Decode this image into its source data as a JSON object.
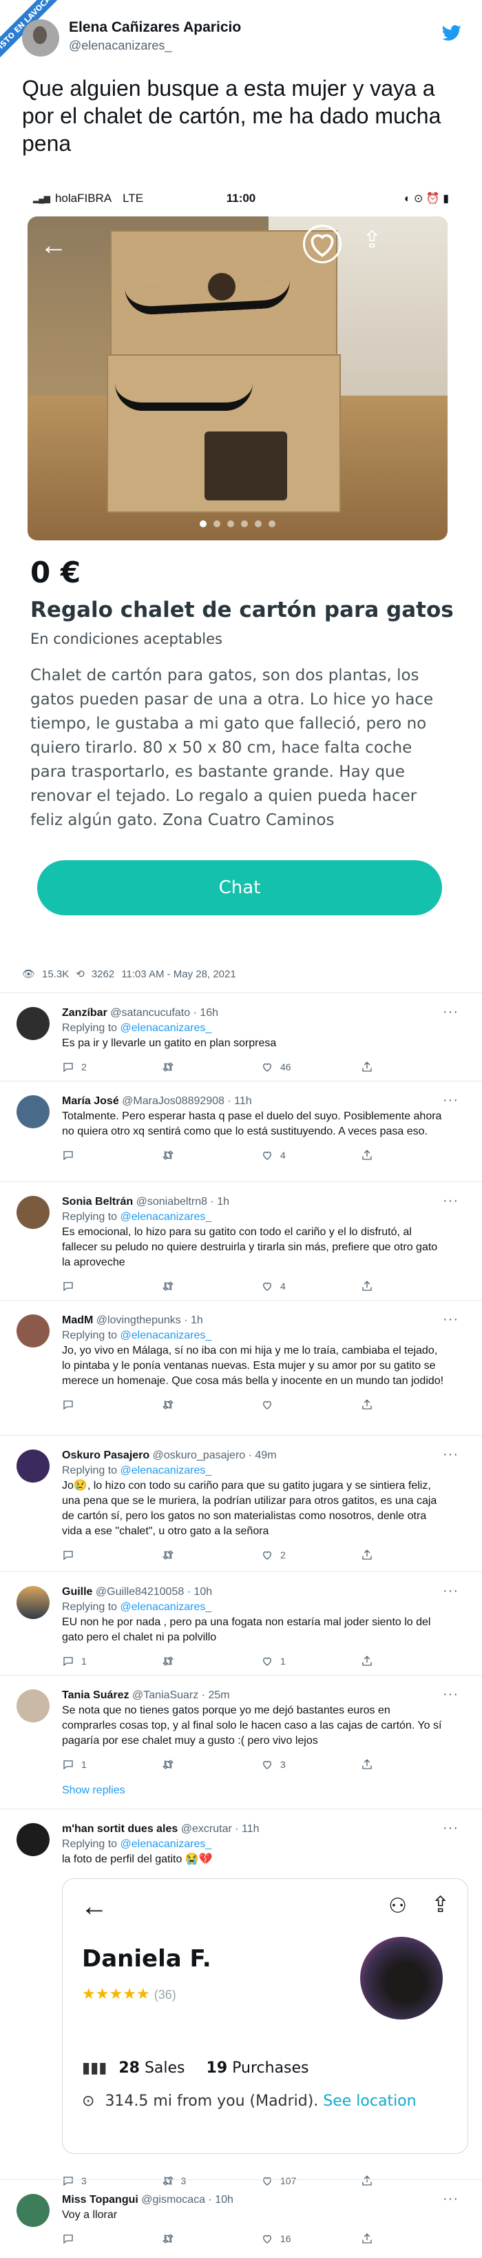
{
  "watermark": "VISTO EN LAVOCALUCA",
  "tweet": {
    "name": "Elena Cañizares Aparicio",
    "handle": "@elenacanizares_",
    "text": "Que alguien busque a esta mujer y vaya a por el chalet de cartón, me ha dado mucha pena",
    "views": "15.3K",
    "retweets": "3262",
    "timestamp": "11:03 AM - May 28, 2021"
  },
  "screenshot": {
    "carrier": "holaFIBRA",
    "network": "LTE",
    "time": "11:00",
    "price": "0 €",
    "title": "Regalo chalet de cartón para gatos",
    "condition": "En condiciones aceptables",
    "description": "Chalet de cartón para gatos, son dos plantas, los gatos pueden pasar de una a otra. Lo hice yo hace tiempo, le gustaba a mi gato que falleció, pero no quiero tirarlo. 80 x 50 x 80 cm, hace falta coche para trasportarlo, es bastante grande. Hay que renovar el tejado. Lo regalo a quien pueda hacer feliz algún gato. Zona Cuatro Caminos",
    "chat_label": "Chat",
    "colors": {
      "accent": "#13c1ac"
    }
  },
  "replies": [
    {
      "name": "Zanzíbar",
      "handle": "@satancucufato",
      "time": "16h",
      "to": "@elenacanizares_",
      "text": "Es pa ir y llevarle un gatito en plan sorpresa",
      "reply": "2",
      "rt": "",
      "like": "46"
    },
    {
      "name": "María José",
      "handle": "@MaraJos08892908",
      "time": "11h",
      "to": "",
      "text": "Totalmente. Pero esperar hasta q pase el duelo del suyo. Posiblemente ahora no quiera otro xq sentirá como que lo está sustituyendo. A veces pasa eso.",
      "reply": "",
      "rt": "",
      "like": "4"
    },
    {
      "name": "Sonia Beltrán",
      "handle": "@soniabeltrn8",
      "time": "1h",
      "to": "@elenacanizares_",
      "text": "Es emocional, lo hizo para su gatito con todo el cariño y el lo disfrutó, al fallecer su peludo no quiere destruirla y tirarla sin más, prefiere que otro gato la aproveche",
      "reply": "",
      "rt": "",
      "like": "4"
    },
    {
      "name": "MadM",
      "handle": "@lovingthepunks",
      "time": "1h",
      "to": "@elenacanizares_",
      "text": "Jo, yo vivo en Málaga, sí no iba con mi hija y me lo traía, cambiaba el tejado, lo pintaba y le ponía ventanas nuevas. Esta mujer y su amor por su gatito se merece un homenaje. Que cosa más bella y inocente en un mundo tan jodido!",
      "reply": "",
      "rt": "",
      "like": ""
    },
    {
      "name": "Oskuro Pasajero",
      "handle": "@oskuro_pasajero",
      "time": "49m",
      "to": "@elenacanizares_",
      "text": "Jo😢, lo hizo con todo su cariño para que su gatito jugara y se sintiera feliz, una pena que se le muriera, la podrían utilizar para otros gatitos, es una caja de cartón sí, pero los gatos no son materialistas como nosotros, denle otra vida a ese \"chalet\", u otro gato a la señora",
      "reply": "",
      "rt": "",
      "like": "2"
    },
    {
      "name": "Guille",
      "handle": "@Guille84210058",
      "time": "10h",
      "to": "@elenacanizares_",
      "text": "EU non he por nada , pero pa una fogata non estaría mal joder siento lo del gato pero el chalet ni pa polvillo",
      "reply": "1",
      "rt": "",
      "like": "1"
    },
    {
      "name": "Tania Suárez",
      "handle": "@TaniaSuarz",
      "time": "25m",
      "to": "",
      "text": "Se nota que no tienes gatos porque yo me dejó bastantes euros en comprarles cosas top, y al final solo le hacen caso a las cajas de cartón. Yo sí pagaría por ese chalet muy a gusto :( pero vivo lejos",
      "reply": "1",
      "rt": "",
      "like": "3"
    },
    {
      "name": "m'han sortit dues ales",
      "handle": "@excrutar",
      "time": "11h",
      "to": "@elenacanizares_",
      "text": "la foto de perfil del gatito 😭💔",
      "reply": "3",
      "rt": "3",
      "like": "107"
    },
    {
      "name": "Miss Topangui",
      "handle": "@gismocaca",
      "time": "10h",
      "to": "",
      "text": "Voy a llorar",
      "reply": "",
      "rt": "",
      "like": "16"
    }
  ],
  "show_replies": "Show replies",
  "profile_card": {
    "name": "Daniela F.",
    "rating_count": "(36)",
    "sales": "28",
    "sales_label": "Sales",
    "purchases": "19",
    "purchases_label": "Purchases",
    "location": "314.5 mi from you (Madrid).",
    "location_link": "See location"
  }
}
